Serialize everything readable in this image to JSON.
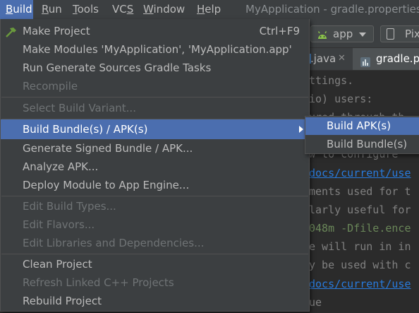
{
  "menubar": {
    "items": [
      {
        "mnemonic": "B",
        "rest": "uild"
      },
      {
        "mnemonic": "R",
        "rest": "un"
      },
      {
        "mnemonic": "T",
        "rest": "ools"
      },
      {
        "pre": "VC",
        "mnemonic": "S"
      },
      {
        "mnemonic": "W",
        "rest": "indow"
      },
      {
        "mnemonic": "H",
        "rest": "elp"
      }
    ],
    "window_title": "MyApplication - gradle.properties"
  },
  "toolbar": {
    "run_config": "app",
    "device": "Pix"
  },
  "tabs": [
    {
      "label": ".java"
    },
    {
      "label": "gradle.p"
    }
  ],
  "editor": {
    "lines": [
      "ttings.",
      "io) users:",
      "ured through th",
      "w to configure",
      "docs/current/use",
      "ments used for t",
      "larly useful for",
      "048m -Dfile.ence",
      "e will run in in",
      "y be used with c",
      "docs/current/use",
      "ue"
    ]
  },
  "build_menu": {
    "items": [
      {
        "label": "Make Project",
        "shortcut": "Ctrl+F9"
      },
      {
        "label": "Make Modules 'MyApplication', 'MyApplication.app'"
      },
      {
        "label": "Run Generate Sources Gradle Tasks"
      },
      {
        "label": "Recompile"
      },
      {
        "label": "Select Build Variant..."
      },
      {
        "label": "Build Bundle(s) / APK(s)"
      },
      {
        "label": "Generate Signed Bundle / APK..."
      },
      {
        "label": "Analyze APK..."
      },
      {
        "label": "Deploy Module to App Engine..."
      },
      {
        "label": "Edit Build Types..."
      },
      {
        "label": "Edit Flavors..."
      },
      {
        "label": "Edit Libraries and Dependencies..."
      },
      {
        "label": "Clean Project"
      },
      {
        "label": "Refresh Linked C++ Projects"
      },
      {
        "label": "Rebuild Project"
      }
    ]
  },
  "submenu": {
    "items": [
      {
        "label": "Build APK(s)"
      },
      {
        "label": "Build Bundle(s)"
      }
    ]
  },
  "colors": {
    "selection": "#4b6eaf",
    "menu_bg": "#3c3f41",
    "editor_bg": "#2b2b2b",
    "link": "#287bde",
    "string_green": "#6a8759",
    "android_green": "#8bc34a",
    "hammer_green": "#6a9a3d"
  },
  "icons": [
    "hammer-icon",
    "android-icon",
    "device-icon",
    "java-file-icon",
    "gradle-file-icon",
    "close-icon",
    "submenu-arrow-icon",
    "dropdown-arrow-icon"
  ]
}
